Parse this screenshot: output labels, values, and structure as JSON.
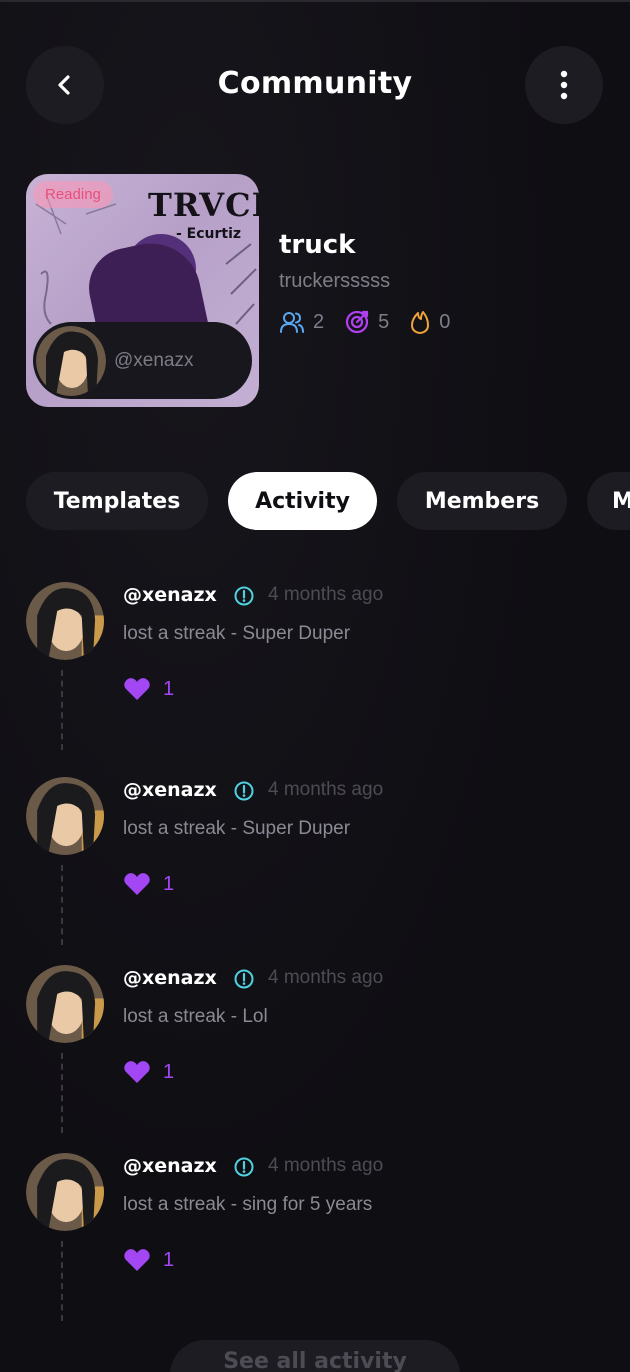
{
  "header": {
    "title": "Community",
    "back_icon": "chevron-left-icon",
    "more_icon": "more-vertical-icon"
  },
  "cover": {
    "badge": "Reading",
    "art_title": "TRVCK",
    "art_subtitle": "- Ecurtiz",
    "owner_handle": "@xenazx"
  },
  "community": {
    "name": "truck",
    "subtitle": "truckersssss",
    "stats": {
      "members": "2",
      "target": "5",
      "streak": "0"
    }
  },
  "tabs": [
    {
      "label": "Templates",
      "active": false
    },
    {
      "label": "Activity",
      "active": true
    },
    {
      "label": "Members",
      "active": false
    },
    {
      "label": "M",
      "active": false
    }
  ],
  "feed": [
    {
      "user": "@xenazx",
      "time": "4 months ago",
      "text": "lost a streak - Super Duper",
      "likes": "1"
    },
    {
      "user": "@xenazx",
      "time": "4 months ago",
      "text": "lost a streak - Super Duper",
      "likes": "1"
    },
    {
      "user": "@xenazx",
      "time": "4 months ago",
      "text": "lost a streak - Lol",
      "likes": "1"
    },
    {
      "user": "@xenazx",
      "time": "4 months ago",
      "text": "lost a streak - sing for 5 years",
      "likes": "1"
    }
  ],
  "see_all_label": "See all activity",
  "colors": {
    "background": "#0f0e13",
    "surface": "#1d1c23",
    "accent_purple": "#a347f5",
    "info_cyan": "#4fd1e0",
    "members_blue": "#5aa7f0",
    "streak_orange": "#f0a23a"
  }
}
